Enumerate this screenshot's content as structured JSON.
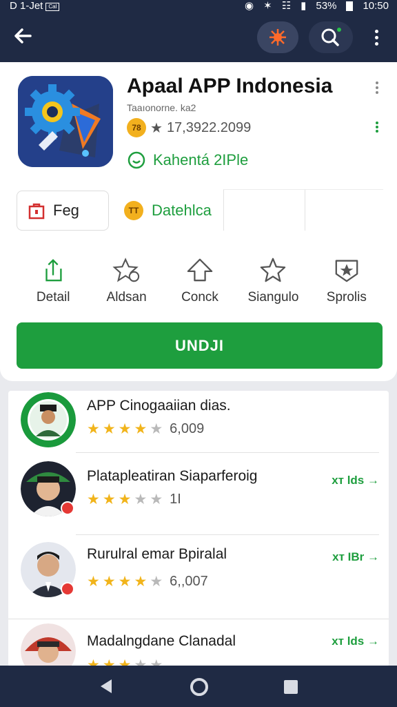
{
  "status_bar": {
    "left_text": "D 1-Jet",
    "left_box": "Cal",
    "battery": "53%",
    "time": "10:50",
    "icons": [
      "alarm-icon",
      "bluetooth-icon",
      "wifi-icon",
      "signal-icon",
      "battery-icon"
    ]
  },
  "app_bar": {
    "icons": [
      "back-arrow-icon",
      "spark-icon",
      "search-icon",
      "more-vert-icon"
    ]
  },
  "app": {
    "title": "Apaal APP Indonesia",
    "developer": "Taaıonorne. ka2",
    "badge_text": "78",
    "rating_count": "17,3922.2099",
    "category": "Kahentá 2IPle"
  },
  "chips": {
    "flag_label": "Feg",
    "developer_label": "Datehlca",
    "developer_badge": "TT"
  },
  "actions": [
    {
      "label": "Detail",
      "icon": "share-icon"
    },
    {
      "label": "Aldsan",
      "icon": "star-add-icon"
    },
    {
      "label": "Conck",
      "icon": "up-arrow-icon"
    },
    {
      "label": "Siangulo",
      "icon": "star-outline-icon"
    },
    {
      "label": "Sprolis",
      "icon": "star-badge-icon"
    }
  ],
  "download_label": "UNDJI",
  "list": [
    {
      "name": "APP Cinogaaiian dias.",
      "stars": 4,
      "count": "6,009",
      "action": ""
    },
    {
      "name": "Platapleatiran Siaparferoig",
      "stars": 3,
      "count": "1I",
      "action": "хт lds"
    },
    {
      "name": "Rurulral emar Bpiralal",
      "stars": 4,
      "count": "6,,007",
      "action": "хт IBr"
    },
    {
      "name": "Madalngdane Clanadal",
      "stars": 3,
      "count": "",
      "action": "хт lds"
    }
  ],
  "colors": {
    "accent_green": "#1e9e3e",
    "dark_bar": "#1f2a44",
    "star_gold": "#f1b41b"
  },
  "nav_bar": {
    "icons": [
      "nav-back-icon",
      "nav-home-icon",
      "nav-recents-icon"
    ]
  }
}
